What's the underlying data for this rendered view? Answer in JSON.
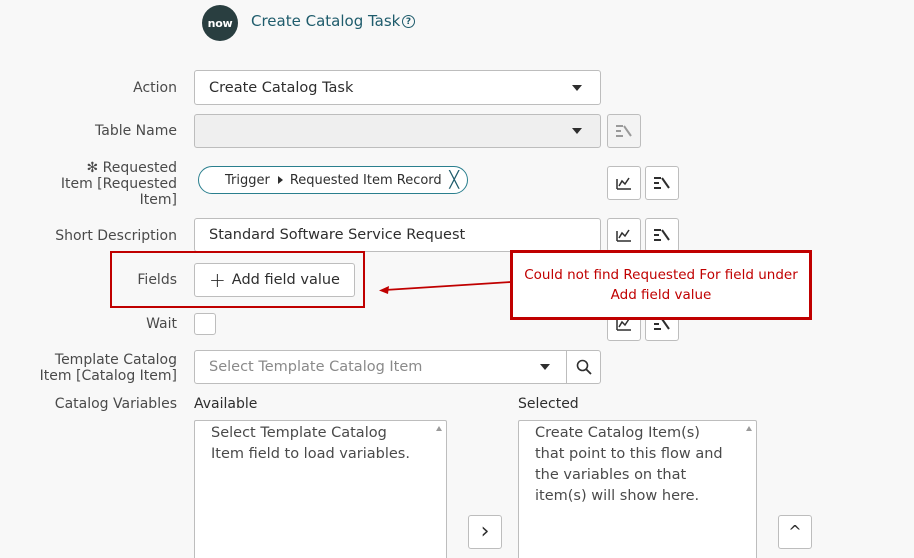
{
  "header": {
    "logo_text": "now",
    "title": "Create Catalog Task",
    "help_glyph": "?"
  },
  "form": {
    "action": {
      "label": "Action",
      "value": "Create Catalog Task"
    },
    "table_name": {
      "label": "Table Name",
      "value": ""
    },
    "requested_item": {
      "label_line1": "✻ Requested",
      "label_line2": "Item [Requested",
      "label_line3": "Item]",
      "pill_source": "Trigger",
      "pill_value": "Requested Item Record",
      "pill_remove": "╳"
    },
    "short_description": {
      "label": "Short Description",
      "value": "Standard Software Service Request"
    },
    "fields": {
      "label": "Fields",
      "add_button": "Add field value",
      "add_glyph": "+"
    },
    "wait": {
      "label": "Wait",
      "checked": false
    },
    "template_catalog_item": {
      "label_line1": "Template Catalog",
      "label_line2": "Item [Catalog Item]",
      "placeholder": "Select Template Catalog Item"
    },
    "catalog_variables": {
      "label": "Catalog Variables",
      "available_label": "Available",
      "available_text": [
        "Select Template Catalog",
        "Item field to load variables."
      ],
      "selected_label": "Selected",
      "selected_text": [
        "Create Catalog Item(s)",
        "that point to this flow and",
        "the variables on that",
        "item(s) will show here."
      ],
      "move_glyph": "›",
      "up_glyph": "^"
    }
  },
  "annotation": {
    "line1": "Could not find Requested For field under",
    "line2": "Add field value"
  },
  "colors": {
    "accent": "#1f5c6c",
    "annotation": "#c00000",
    "logo_bg": "#293e40"
  }
}
